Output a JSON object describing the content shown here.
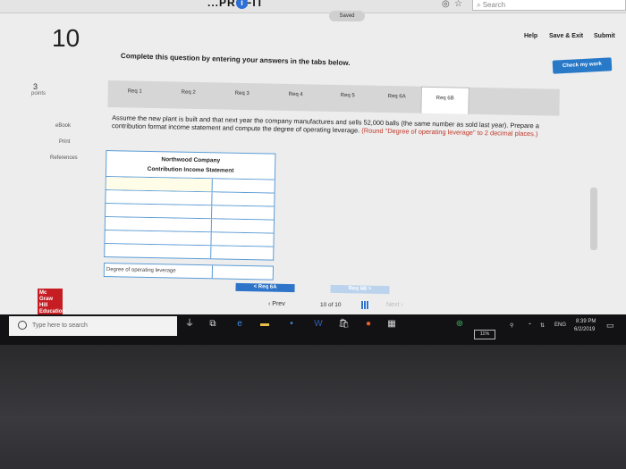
{
  "browser": {
    "tab_title": "...PROFIT",
    "search_placeholder": "Search",
    "info_icon": "info-icon"
  },
  "header": {
    "saved_label": "Saved",
    "question_number": "10",
    "help_label": "Help",
    "save_exit_label": "Save & Exit",
    "submit_label": "Submit",
    "check_label": "Check my work"
  },
  "instruction": "Complete this question by entering your answers in the tabs below.",
  "points": {
    "value": "3",
    "label": "points"
  },
  "sidebar": {
    "items": [
      {
        "label": "eBook"
      },
      {
        "label": "Print"
      },
      {
        "label": "References"
      }
    ]
  },
  "tabs": [
    {
      "label": "Req 1"
    },
    {
      "label": "Req 2"
    },
    {
      "label": "Req 3"
    },
    {
      "label": "Req 4"
    },
    {
      "label": "Req 5"
    },
    {
      "label": "Req 6A"
    },
    {
      "label": "Req 6B"
    }
  ],
  "question": {
    "text": "Assume the new plant is built and that next year the company manufactures and sells 52,000 balls (the same number as sold last year). Prepare a contribution format income statement and compute the degree of operating leverage.",
    "hint": "(Round \"Degree of operating leverage\" to 2 decimal places.)"
  },
  "statement": {
    "company": "Northwood Company",
    "title": "Contribution Income Statement",
    "dol_label": "Degree of operating leverage"
  },
  "tab_nav": {
    "prev_label": "< Req 6A",
    "next_label": "Req 6B >"
  },
  "pager": {
    "prev_label": "Prev",
    "current": "10",
    "of": "of",
    "total": "10",
    "next_label": "Next"
  },
  "logo": {
    "text": "Mc Graw Hill Education"
  },
  "taskbar": {
    "search_placeholder": "Type here to search",
    "battery": "11%",
    "lang": "ENG",
    "time": "8:39 PM",
    "date": "6/2/2019"
  },
  "colors": {
    "accent": "#2979c9",
    "hint_red": "#c0392b",
    "table_border": "#5b9bd5"
  }
}
